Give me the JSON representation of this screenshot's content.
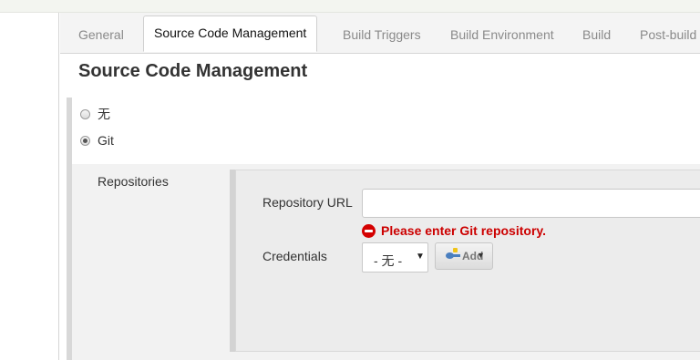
{
  "tabs": [
    {
      "label": "General"
    },
    {
      "label": "Source Code Management",
      "active": true
    },
    {
      "label": "Build Triggers"
    },
    {
      "label": "Build Environment"
    },
    {
      "label": "Build"
    },
    {
      "label": "Post-build"
    }
  ],
  "section": {
    "title": "Source Code Management"
  },
  "scm_options": [
    {
      "label": "无",
      "selected": false
    },
    {
      "label": "Git",
      "selected": true
    }
  ],
  "git": {
    "repositories_label": "Repositories",
    "repo_url_label": "Repository URL",
    "repo_url_value": "",
    "error_message": "Please enter Git repository.",
    "credentials_label": "Credentials",
    "credentials_selected": "- 无 -",
    "add_button_label": "Add"
  },
  "colors": {
    "error": "#cc0000",
    "panel": "#f2f2f2",
    "tabbar": "#f4f4f4"
  }
}
